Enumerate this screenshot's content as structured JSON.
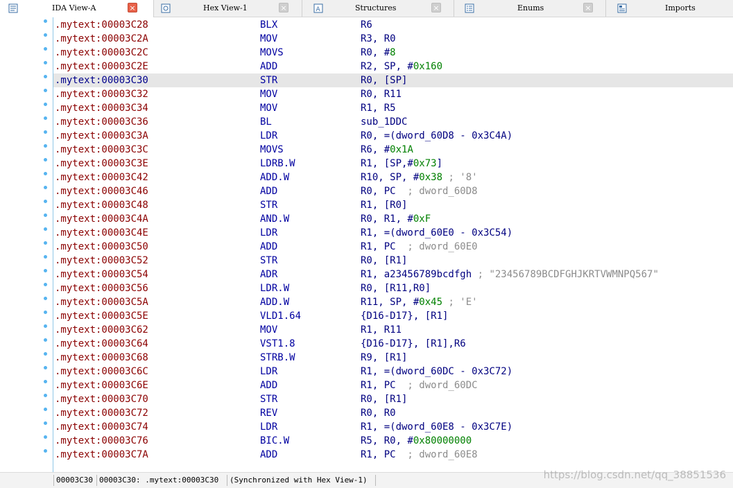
{
  "tabs": [
    {
      "label": "IDA View-A",
      "icon": "listing-icon",
      "active": true
    },
    {
      "label": "Hex View-1",
      "icon": "hex-view-icon",
      "active": false
    },
    {
      "label": "Structures",
      "icon": "structures-icon",
      "active": false
    },
    {
      "label": "Enums",
      "icon": "enums-icon",
      "active": false
    },
    {
      "label": "Imports",
      "icon": "imports-icon",
      "active": false
    }
  ],
  "close_symbol": "×",
  "listing": {
    "selected_row": 4,
    "rows": [
      {
        "addr": ".mytext:00003C28",
        "mnem": "BLX",
        "ops": [
          {
            "t": "R6"
          }
        ]
      },
      {
        "addr": ".mytext:00003C2A",
        "mnem": "MOV",
        "ops": [
          {
            "t": "R3, R0"
          }
        ]
      },
      {
        "addr": ".mytext:00003C2C",
        "mnem": "MOVS",
        "ops": [
          {
            "t": "R0, #"
          },
          {
            "t": "8",
            "c": "num"
          }
        ]
      },
      {
        "addr": ".mytext:00003C2E",
        "mnem": "ADD",
        "ops": [
          {
            "t": "R2, SP, #"
          },
          {
            "t": "0x160",
            "c": "num"
          }
        ]
      },
      {
        "addr": ".mytext:00003C30",
        "mnem": "STR",
        "ops": [
          {
            "t": "R0, [SP]"
          }
        ]
      },
      {
        "addr": ".mytext:00003C32",
        "mnem": "MOV",
        "ops": [
          {
            "t": "R0, R11"
          }
        ]
      },
      {
        "addr": ".mytext:00003C34",
        "mnem": "MOV",
        "ops": [
          {
            "t": "R1, R5"
          }
        ]
      },
      {
        "addr": ".mytext:00003C36",
        "mnem": "BL",
        "ops": [
          {
            "t": "sub_1DDC"
          }
        ]
      },
      {
        "addr": ".mytext:00003C3A",
        "mnem": "LDR",
        "ops": [
          {
            "t": "R0, =(dword_60D8 - 0x3C4A)"
          }
        ]
      },
      {
        "addr": ".mytext:00003C3C",
        "mnem": "MOVS",
        "ops": [
          {
            "t": "R6, #"
          },
          {
            "t": "0x1A",
            "c": "num"
          }
        ]
      },
      {
        "addr": ".mytext:00003C3E",
        "mnem": "LDRB.W",
        "ops": [
          {
            "t": "R1, [SP,#"
          },
          {
            "t": "0x73",
            "c": "num"
          },
          {
            "t": "]"
          }
        ]
      },
      {
        "addr": ".mytext:00003C42",
        "mnem": "ADD.W",
        "ops": [
          {
            "t": "R10, SP, #"
          },
          {
            "t": "0x38",
            "c": "num"
          },
          {
            "t": " ; '8'",
            "c": "cmt"
          }
        ]
      },
      {
        "addr": ".mytext:00003C46",
        "mnem": "ADD",
        "ops": [
          {
            "t": "R0, PC"
          },
          {
            "t": "  ; dword_60D8",
            "c": "cmt"
          }
        ]
      },
      {
        "addr": ".mytext:00003C48",
        "mnem": "STR",
        "ops": [
          {
            "t": "R1, [R0]"
          }
        ]
      },
      {
        "addr": ".mytext:00003C4A",
        "mnem": "AND.W",
        "ops": [
          {
            "t": "R0, R1, #"
          },
          {
            "t": "0xF",
            "c": "num"
          }
        ]
      },
      {
        "addr": ".mytext:00003C4E",
        "mnem": "LDR",
        "ops": [
          {
            "t": "R1, =(dword_60E0 - 0x3C54)"
          }
        ]
      },
      {
        "addr": ".mytext:00003C50",
        "mnem": "ADD",
        "ops": [
          {
            "t": "R1, PC"
          },
          {
            "t": "  ; dword_60E0",
            "c": "cmt"
          }
        ]
      },
      {
        "addr": ".mytext:00003C52",
        "mnem": "STR",
        "ops": [
          {
            "t": "R0, [R1]"
          }
        ]
      },
      {
        "addr": ".mytext:00003C54",
        "mnem": "ADR",
        "ops": [
          {
            "t": "R1, a23456789bcdfgh"
          },
          {
            "t": " ; \"23456789BCDFGHJKRTVWMNPQ567\"",
            "c": "cmt"
          }
        ]
      },
      {
        "addr": ".mytext:00003C56",
        "mnem": "LDR.W",
        "ops": [
          {
            "t": "R0, [R11,R0]"
          }
        ]
      },
      {
        "addr": ".mytext:00003C5A",
        "mnem": "ADD.W",
        "ops": [
          {
            "t": "R11, SP, #"
          },
          {
            "t": "0x45",
            "c": "num"
          },
          {
            "t": " ; 'E'",
            "c": "cmt"
          }
        ]
      },
      {
        "addr": ".mytext:00003C5E",
        "mnem": "VLD1.64",
        "ops": [
          {
            "t": "{D16-D17}, [R1]"
          }
        ]
      },
      {
        "addr": ".mytext:00003C62",
        "mnem": "MOV",
        "ops": [
          {
            "t": "R1, R11"
          }
        ]
      },
      {
        "addr": ".mytext:00003C64",
        "mnem": "VST1.8",
        "ops": [
          {
            "t": "{D16-D17}, [R1],R6"
          }
        ]
      },
      {
        "addr": ".mytext:00003C68",
        "mnem": "STRB.W",
        "ops": [
          {
            "t": "R9, [R1]"
          }
        ]
      },
      {
        "addr": ".mytext:00003C6C",
        "mnem": "LDR",
        "ops": [
          {
            "t": "R1, =(dword_60DC - 0x3C72)"
          }
        ]
      },
      {
        "addr": ".mytext:00003C6E",
        "mnem": "ADD",
        "ops": [
          {
            "t": "R1, PC"
          },
          {
            "t": "  ; dword_60DC",
            "c": "cmt"
          }
        ]
      },
      {
        "addr": ".mytext:00003C70",
        "mnem": "STR",
        "ops": [
          {
            "t": "R0, [R1]"
          }
        ]
      },
      {
        "addr": ".mytext:00003C72",
        "mnem": "REV",
        "ops": [
          {
            "t": "R0, R0"
          }
        ]
      },
      {
        "addr": ".mytext:00003C74",
        "mnem": "LDR",
        "ops": [
          {
            "t": "R1, =(dword_60E8 - 0x3C7E)"
          }
        ]
      },
      {
        "addr": ".mytext:00003C76",
        "mnem": "BIC.W",
        "ops": [
          {
            "t": "R5, R0, #"
          },
          {
            "t": "0x80000000",
            "c": "num"
          }
        ]
      },
      {
        "addr": ".mytext:00003C7A",
        "mnem": "ADD",
        "ops": [
          {
            "t": "R1, PC"
          },
          {
            "t": "  ; dword_60E8",
            "c": "cmt"
          }
        ]
      }
    ]
  },
  "status": {
    "offset": "00003C30",
    "location": "00003C30: .mytext:00003C30",
    "sync": "(Synchronized with Hex View-1)"
  },
  "watermark": "https://blog.csdn.net/qq_38851536",
  "colors": {
    "address": "#8b0000",
    "mnemonic": "#0000a0",
    "operand": "#000080",
    "number": "#008000",
    "comment": "#8c8c8c",
    "selection": "#e6e6e6",
    "close_active": "#e8624a"
  }
}
